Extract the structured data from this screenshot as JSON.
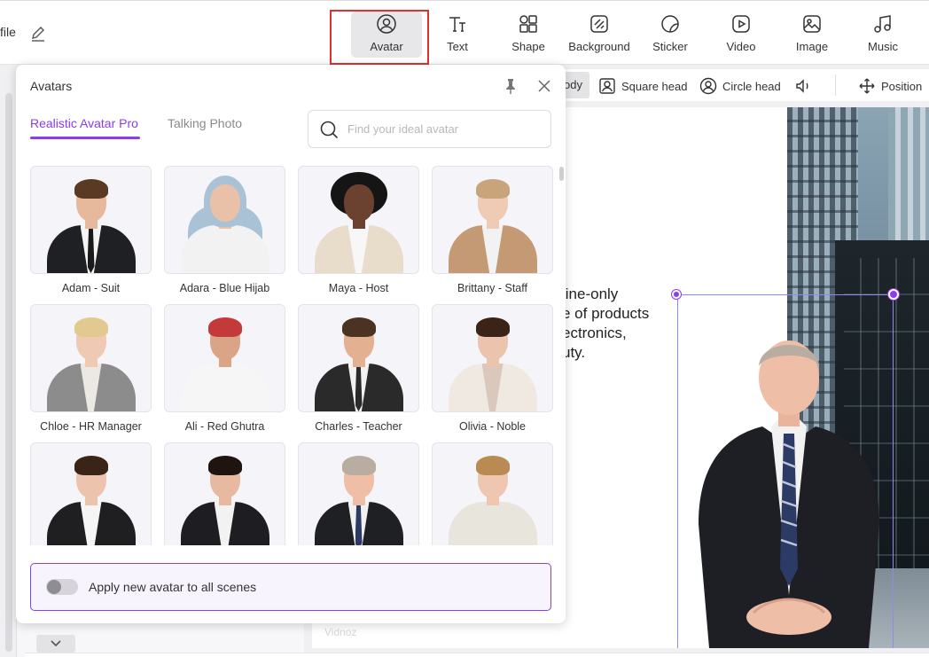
{
  "header": {
    "file_label": "file",
    "tools": [
      {
        "label": "Avatar",
        "icon": "avatar-icon",
        "active": true
      },
      {
        "label": "Text",
        "icon": "text-icon"
      },
      {
        "label": "Shape",
        "icon": "shape-icon"
      },
      {
        "label": "Background",
        "icon": "background-icon"
      },
      {
        "label": "Sticker",
        "icon": "sticker-icon"
      },
      {
        "label": "Video",
        "icon": "video-icon"
      },
      {
        "label": "Image",
        "icon": "image-icon"
      },
      {
        "label": "Music",
        "icon": "music-icon"
      }
    ]
  },
  "subbar": {
    "body_label": "ody",
    "square_head": "Square head",
    "circle_head": "Circle head",
    "position": "Position"
  },
  "canvas": {
    "text_lines": [
      "line-only",
      "e of products",
      "ectronics,",
      "uty."
    ],
    "watermark": "Vidnoz"
  },
  "popup": {
    "title": "Avatars",
    "tabs": [
      "Realistic Avatar Pro",
      "Talking Photo"
    ],
    "search_placeholder": "Find your ideal avatar",
    "avatars": [
      {
        "name": "Adam - Suit"
      },
      {
        "name": "Adara - Blue Hijab"
      },
      {
        "name": "Maya - Host"
      },
      {
        "name": "Brittany - Staff"
      },
      {
        "name": "Chloe - HR Manager"
      },
      {
        "name": "Ali - Red Ghutra"
      },
      {
        "name": "Charles - Teacher"
      },
      {
        "name": "Olivia - Noble"
      },
      {
        "name": ""
      },
      {
        "name": ""
      },
      {
        "name": ""
      },
      {
        "name": ""
      }
    ],
    "apply_label": "Apply new avatar to all scenes"
  },
  "colors": {
    "accent": "#8a3cf0",
    "highlight": "#e03030"
  }
}
